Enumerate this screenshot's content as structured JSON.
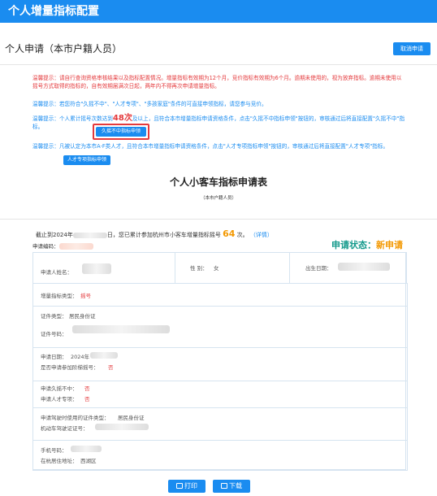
{
  "header": {
    "title": "个人增量指标配置"
  },
  "section": {
    "title": "个人申请（本市户籍人员）",
    "cancel_label": "取消申请"
  },
  "notices": {
    "n1": "温馨提示：请自行查询资格审核结果以及指标配置情况。增量指标有效期为12个月，竞价指标有效期为6个月。逾期未使用的，视为放弃指标。逾期未使用以摇号方式取得的指标的，自有效期届满次日起，两年内不得再次申请增量指标。",
    "n2": "温馨提示：若您符合\"久摇不中\"、\"人才专项\"、\"多孩家庭\"条件的可直接申领指标，请您参与竞价。",
    "n3_pre": "温馨提示：个人累计摇号次数达到",
    "n3_num": "48次",
    "n3_post": "及以上，且符合本市增量指标申请资格条件，点击\"久摇不中指标申领\"按钮的，审核通过后将直接配置\"久摇不中\"指标。",
    "n3_btn": "久摇不中指标申领",
    "n4": "温馨提示：凡被认定为本市A-F类人才，且符合本市增量指标申请资格条件，点击\"人才专项指标申领\"按钮的，审核通过后将直接配置\"人才专项\"指标。",
    "n4_btn": "人才专项指标申领"
  },
  "form": {
    "title": "个人小客车指标申请表",
    "subtitle": "（本市户籍人员）",
    "stat_pre": "截止到2024年",
    "stat_mid": "日，您已累计参加杭州市小客车增量指标摇号",
    "stat_num": "64",
    "stat_post": "次。",
    "stat_link": "（详情）",
    "appno_label": "申请编码：",
    "status_label": "申请状态：",
    "status_value": "新申请",
    "name_label": "申请人姓名：",
    "gender_label": "性 别：",
    "gender_value": "女",
    "birth_label": "出生日期：",
    "quota_type_label": "增量指标类型：",
    "quota_type_value": "摇号",
    "id_type_label": "证件类型：",
    "id_type_value": "居民身份证",
    "id_no_label": "证件号码：",
    "apply_date_label": "申请日期：",
    "apply_date_value": "2024年",
    "auction_label": "是否申请参加阶梯摇号：",
    "auction_value": "否",
    "long_label": "申请久摇不中：",
    "long_value": "否",
    "talent_label": "申请人才专项：",
    "talent_value": "否",
    "driver_type_label": "申请驾驶时使用的证件类型：",
    "driver_type_value": "居民身份证",
    "driver_no_label": "机动车驾驶证证号：",
    "phone_label": "手机号码：",
    "addr_label": "在杭居住地址：",
    "addr_value": "西湖区"
  },
  "actions": {
    "print_label": "打印",
    "download_label": "下载"
  },
  "colors": {
    "primary": "#1a8cf0",
    "warning": "#e4393c",
    "orange": "#f39800",
    "teal": "#159a8c"
  }
}
